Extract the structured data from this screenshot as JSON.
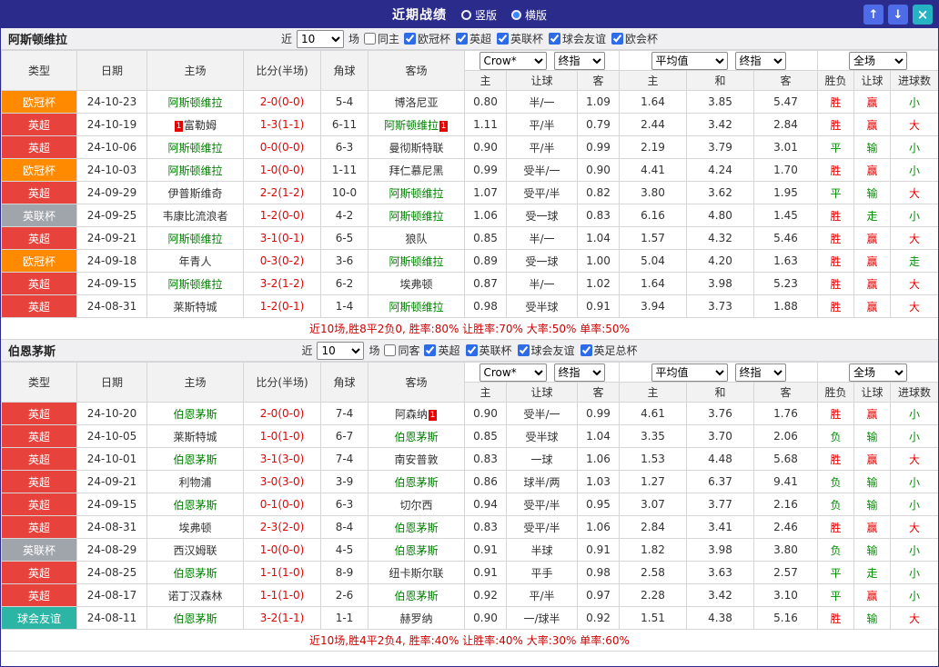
{
  "titlebar": {
    "title": "近期战绩",
    "radio_vertical": "竖版",
    "radio_horizontal": "横版",
    "selected_view": "横版",
    "up_icon": "↑",
    "down_icon": "↓",
    "close_icon": "×"
  },
  "filters": {
    "near": "近",
    "count": "10",
    "games": "场",
    "bookmaker": "Crow*",
    "final1": "终指",
    "average": "平均值",
    "final2": "终指",
    "scope": "全场"
  },
  "columns": {
    "type": "类型",
    "date": "日期",
    "home": "主场",
    "score": "比分(半场)",
    "corner": "角球",
    "away": "客场",
    "odds_home": "主",
    "odds_handicap": "让球",
    "odds_away": "客",
    "avg_home": "主",
    "avg_draw": "和",
    "avg_away": "客",
    "result_wl": "胜负",
    "result_handicap": "让球",
    "result_goals": "进球数"
  },
  "colors": {
    "accent": "#2b2b8c",
    "win_red": "#e60000",
    "lose_green": "#009000",
    "focus_team_green": "#008000"
  },
  "league_colors": {
    "欧冠杯": "#ff8a00",
    "英超": "#e8423c",
    "英联杯": "#a0a5ab",
    "球会友谊": "#2cb5a5"
  },
  "sections": [
    {
      "team": "阿斯顿维拉",
      "same_side_label": "同主",
      "same_side_checked": false,
      "league_filters": [
        {
          "label": "欧冠杯",
          "checked": true
        },
        {
          "label": "英超",
          "checked": true
        },
        {
          "label": "英联杯",
          "checked": true
        },
        {
          "label": "球会友谊",
          "checked": true
        },
        {
          "label": "欧会杯",
          "checked": true
        }
      ],
      "rows": [
        {
          "league": "欧冠杯",
          "date": "24-10-23",
          "home": "阿斯顿维拉",
          "hf": true,
          "hb": "",
          "score": "2-0(0-0)",
          "corner": "5-4",
          "away": "博洛尼亚",
          "af": false,
          "ab": "",
          "odds": [
            "0.80",
            "半/一",
            "1.09"
          ],
          "avg": [
            "1.64",
            "3.85",
            "5.47"
          ],
          "res": [
            [
              "胜",
              "r"
            ],
            [
              "赢",
              "r"
            ],
            [
              "小",
              "g"
            ]
          ]
        },
        {
          "league": "英超",
          "date": "24-10-19",
          "home": "富勒姆",
          "hf": false,
          "hb": "1",
          "score": "1-3(1-1)",
          "corner": "6-11",
          "away": "阿斯顿维拉",
          "af": true,
          "ab": "1",
          "odds": [
            "1.11",
            "平/半",
            "0.79"
          ],
          "avg": [
            "2.44",
            "3.42",
            "2.84"
          ],
          "res": [
            [
              "胜",
              "r"
            ],
            [
              "赢",
              "r"
            ],
            [
              "大",
              "r"
            ]
          ]
        },
        {
          "league": "英超",
          "date": "24-10-06",
          "home": "阿斯顿维拉",
          "hf": true,
          "hb": "",
          "score": "0-0(0-0)",
          "corner": "6-3",
          "away": "曼彻斯特联",
          "af": false,
          "ab": "",
          "odds": [
            "0.90",
            "平/半",
            "0.99"
          ],
          "avg": [
            "2.19",
            "3.79",
            "3.01"
          ],
          "res": [
            [
              "平",
              "g"
            ],
            [
              "输",
              "g"
            ],
            [
              "小",
              "g"
            ]
          ]
        },
        {
          "league": "欧冠杯",
          "date": "24-10-03",
          "home": "阿斯顿维拉",
          "hf": true,
          "hb": "",
          "score": "1-0(0-0)",
          "corner": "1-11",
          "away": "拜仁慕尼黑",
          "af": false,
          "ab": "",
          "odds": [
            "0.99",
            "受半/一",
            "0.90"
          ],
          "avg": [
            "4.41",
            "4.24",
            "1.70"
          ],
          "res": [
            [
              "胜",
              "r"
            ],
            [
              "赢",
              "r"
            ],
            [
              "小",
              "g"
            ]
          ]
        },
        {
          "league": "英超",
          "date": "24-09-29",
          "home": "伊普斯维奇",
          "hf": false,
          "hb": "",
          "score": "2-2(1-2)",
          "corner": "10-0",
          "away": "阿斯顿维拉",
          "af": true,
          "ab": "",
          "odds": [
            "1.07",
            "受平/半",
            "0.82"
          ],
          "avg": [
            "3.80",
            "3.62",
            "1.95"
          ],
          "res": [
            [
              "平",
              "g"
            ],
            [
              "输",
              "g"
            ],
            [
              "大",
              "r"
            ]
          ]
        },
        {
          "league": "英联杯",
          "date": "24-09-25",
          "home": "韦康比流浪者",
          "hf": false,
          "hb": "",
          "score": "1-2(0-0)",
          "corner": "4-2",
          "away": "阿斯顿维拉",
          "af": true,
          "ab": "",
          "odds": [
            "1.06",
            "受一球",
            "0.83"
          ],
          "avg": [
            "6.16",
            "4.80",
            "1.45"
          ],
          "res": [
            [
              "胜",
              "r"
            ],
            [
              "走",
              "g"
            ],
            [
              "小",
              "g"
            ]
          ]
        },
        {
          "league": "英超",
          "date": "24-09-21",
          "home": "阿斯顿维拉",
          "hf": true,
          "hb": "",
          "score": "3-1(0-1)",
          "corner": "6-5",
          "away": "狼队",
          "af": false,
          "ab": "",
          "odds": [
            "0.85",
            "半/一",
            "1.04"
          ],
          "avg": [
            "1.57",
            "4.32",
            "5.46"
          ],
          "res": [
            [
              "胜",
              "r"
            ],
            [
              "赢",
              "r"
            ],
            [
              "大",
              "r"
            ]
          ]
        },
        {
          "league": "欧冠杯",
          "date": "24-09-18",
          "home": "年青人",
          "hf": false,
          "hb": "",
          "score": "0-3(0-2)",
          "corner": "3-6",
          "away": "阿斯顿维拉",
          "af": true,
          "ab": "",
          "odds": [
            "0.89",
            "受一球",
            "1.00"
          ],
          "avg": [
            "5.04",
            "4.20",
            "1.63"
          ],
          "res": [
            [
              "胜",
              "r"
            ],
            [
              "赢",
              "r"
            ],
            [
              "走",
              "g"
            ]
          ]
        },
        {
          "league": "英超",
          "date": "24-09-15",
          "home": "阿斯顿维拉",
          "hf": true,
          "hb": "",
          "score": "3-2(1-2)",
          "corner": "6-2",
          "away": "埃弗顿",
          "af": false,
          "ab": "",
          "odds": [
            "0.87",
            "半/一",
            "1.02"
          ],
          "avg": [
            "1.64",
            "3.98",
            "5.23"
          ],
          "res": [
            [
              "胜",
              "r"
            ],
            [
              "赢",
              "r"
            ],
            [
              "大",
              "r"
            ]
          ]
        },
        {
          "league": "英超",
          "date": "24-08-31",
          "home": "莱斯特城",
          "hf": false,
          "hb": "",
          "score": "1-2(0-1)",
          "corner": "1-4",
          "away": "阿斯顿维拉",
          "af": true,
          "ab": "",
          "odds": [
            "0.98",
            "受半球",
            "0.91"
          ],
          "avg": [
            "3.94",
            "3.73",
            "1.88"
          ],
          "res": [
            [
              "胜",
              "r"
            ],
            [
              "赢",
              "r"
            ],
            [
              "大",
              "r"
            ]
          ]
        }
      ],
      "summary": "近10场,胜8平2负0, 胜率:80% 让胜率:70% 大率:50% 单率:50%"
    },
    {
      "team": "伯恩茅斯",
      "same_side_label": "同客",
      "same_side_checked": false,
      "league_filters": [
        {
          "label": "英超",
          "checked": true
        },
        {
          "label": "英联杯",
          "checked": true
        },
        {
          "label": "球会友谊",
          "checked": true
        },
        {
          "label": "英足总杯",
          "checked": true
        }
      ],
      "rows": [
        {
          "league": "英超",
          "date": "24-10-20",
          "home": "伯恩茅斯",
          "hf": true,
          "hb": "",
          "score": "2-0(0-0)",
          "corner": "7-4",
          "away": "阿森纳",
          "af": false,
          "ab": "1",
          "odds": [
            "0.90",
            "受半/一",
            "0.99"
          ],
          "avg": [
            "4.61",
            "3.76",
            "1.76"
          ],
          "res": [
            [
              "胜",
              "r"
            ],
            [
              "赢",
              "r"
            ],
            [
              "小",
              "g"
            ]
          ]
        },
        {
          "league": "英超",
          "date": "24-10-05",
          "home": "莱斯特城",
          "hf": false,
          "hb": "",
          "score": "1-0(1-0)",
          "corner": "6-7",
          "away": "伯恩茅斯",
          "af": true,
          "ab": "",
          "odds": [
            "0.85",
            "受半球",
            "1.04"
          ],
          "avg": [
            "3.35",
            "3.70",
            "2.06"
          ],
          "res": [
            [
              "负",
              "g"
            ],
            [
              "输",
              "g"
            ],
            [
              "小",
              "g"
            ]
          ]
        },
        {
          "league": "英超",
          "date": "24-10-01",
          "home": "伯恩茅斯",
          "hf": true,
          "hb": "",
          "score": "3-1(3-0)",
          "corner": "7-4",
          "away": "南安普敦",
          "af": false,
          "ab": "",
          "odds": [
            "0.83",
            "一球",
            "1.06"
          ],
          "avg": [
            "1.53",
            "4.48",
            "5.68"
          ],
          "res": [
            [
              "胜",
              "r"
            ],
            [
              "赢",
              "r"
            ],
            [
              "大",
              "r"
            ]
          ]
        },
        {
          "league": "英超",
          "date": "24-09-21",
          "home": "利物浦",
          "hf": false,
          "hb": "",
          "score": "3-0(3-0)",
          "corner": "3-9",
          "away": "伯恩茅斯",
          "af": true,
          "ab": "",
          "odds": [
            "0.86",
            "球半/两",
            "1.03"
          ],
          "avg": [
            "1.27",
            "6.37",
            "9.41"
          ],
          "res": [
            [
              "负",
              "g"
            ],
            [
              "输",
              "g"
            ],
            [
              "小",
              "g"
            ]
          ]
        },
        {
          "league": "英超",
          "date": "24-09-15",
          "home": "伯恩茅斯",
          "hf": true,
          "hb": "",
          "score": "0-1(0-0)",
          "corner": "6-3",
          "away": "切尔西",
          "af": false,
          "ab": "",
          "odds": [
            "0.94",
            "受平/半",
            "0.95"
          ],
          "avg": [
            "3.07",
            "3.77",
            "2.16"
          ],
          "res": [
            [
              "负",
              "g"
            ],
            [
              "输",
              "g"
            ],
            [
              "小",
              "g"
            ]
          ]
        },
        {
          "league": "英超",
          "date": "24-08-31",
          "home": "埃弗顿",
          "hf": false,
          "hb": "",
          "score": "2-3(2-0)",
          "corner": "8-4",
          "away": "伯恩茅斯",
          "af": true,
          "ab": "",
          "odds": [
            "0.83",
            "受平/半",
            "1.06"
          ],
          "avg": [
            "2.84",
            "3.41",
            "2.46"
          ],
          "res": [
            [
              "胜",
              "r"
            ],
            [
              "赢",
              "r"
            ],
            [
              "大",
              "r"
            ]
          ]
        },
        {
          "league": "英联杯",
          "date": "24-08-29",
          "home": "西汉姆联",
          "hf": false,
          "hb": "",
          "score": "1-0(0-0)",
          "corner": "4-5",
          "away": "伯恩茅斯",
          "af": true,
          "ab": "",
          "odds": [
            "0.91",
            "半球",
            "0.91"
          ],
          "avg": [
            "1.82",
            "3.98",
            "3.80"
          ],
          "res": [
            [
              "负",
              "g"
            ],
            [
              "输",
              "g"
            ],
            [
              "小",
              "g"
            ]
          ]
        },
        {
          "league": "英超",
          "date": "24-08-25",
          "home": "伯恩茅斯",
          "hf": true,
          "hb": "",
          "score": "1-1(1-0)",
          "corner": "8-9",
          "away": "纽卡斯尔联",
          "af": false,
          "ab": "",
          "odds": [
            "0.91",
            "平手",
            "0.98"
          ],
          "avg": [
            "2.58",
            "3.63",
            "2.57"
          ],
          "res": [
            [
              "平",
              "g"
            ],
            [
              "走",
              "g"
            ],
            [
              "小",
              "g"
            ]
          ]
        },
        {
          "league": "英超",
          "date": "24-08-17",
          "home": "诺丁汉森林",
          "hf": false,
          "hb": "",
          "score": "1-1(1-0)",
          "corner": "2-6",
          "away": "伯恩茅斯",
          "af": true,
          "ab": "",
          "odds": [
            "0.92",
            "平/半",
            "0.97"
          ],
          "avg": [
            "2.28",
            "3.42",
            "3.10"
          ],
          "res": [
            [
              "平",
              "g"
            ],
            [
              "赢",
              "r"
            ],
            [
              "小",
              "g"
            ]
          ]
        },
        {
          "league": "球会友谊",
          "date": "24-08-11",
          "home": "伯恩茅斯",
          "hf": true,
          "hb": "",
          "score": "3-2(1-1)",
          "corner": "1-1",
          "away": "赫罗纳",
          "af": false,
          "ab": "",
          "odds": [
            "0.90",
            "一/球半",
            "0.92"
          ],
          "avg": [
            "1.51",
            "4.38",
            "5.16"
          ],
          "res": [
            [
              "胜",
              "r"
            ],
            [
              "输",
              "g"
            ],
            [
              "大",
              "r"
            ]
          ]
        }
      ],
      "summary": "近10场,胜4平2负4, 胜率:40% 让胜率:40% 大率:30% 单率:60%"
    }
  ]
}
